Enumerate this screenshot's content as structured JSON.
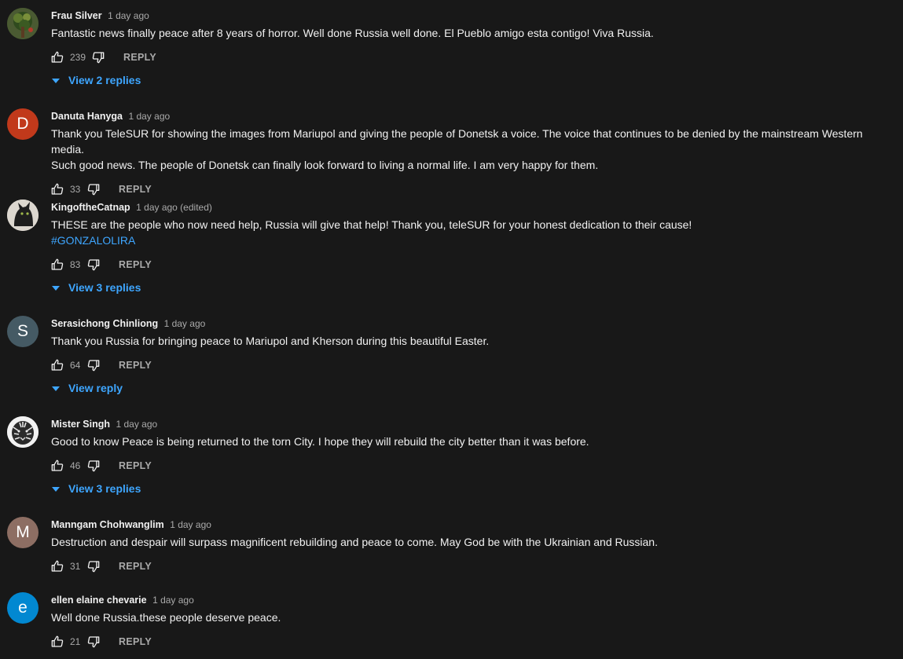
{
  "colors": {
    "background": "#181818",
    "text": "#f1f1f1",
    "secondary_text": "#aaaaaa",
    "link": "#3ea6ff"
  },
  "comments": [
    {
      "author": "Frau Silver",
      "time": "1 day ago",
      "text": "Fantastic news finally peace after 8 years of horror. Well done Russia well done. El Pueblo amigo esta contigo! Viva Russia.",
      "likes": "239",
      "reply_label": "REPLY",
      "replies_label": "View 2 replies",
      "avatar": {
        "type": "image",
        "icon": "profile-photo-tree"
      }
    },
    {
      "author": "Danuta Hanyga",
      "time": "1 day ago",
      "text": "Thank you TeleSUR for showing the images from Mariupol and giving the people of Donetsk a voice. The voice that continues to be denied by the mainstream Western media.\nSuch good news. The people of Donetsk can finally look forward to living a normal life. I am very happy for them.",
      "likes": "33",
      "reply_label": "REPLY",
      "avatar": {
        "type": "letter",
        "letter": "D",
        "color": "#c1391b"
      }
    },
    {
      "author": "KingoftheCatnap",
      "time": "1 day ago (edited)",
      "text": "THESE are the people who now need help, Russia will give that help! Thank you, teleSUR for your honest dedication to their cause!",
      "hashtag": "#GONZALOLIRA",
      "likes": "83",
      "reply_label": "REPLY",
      "replies_label": "View 3 replies",
      "avatar": {
        "type": "image",
        "icon": "profile-photo-cat"
      }
    },
    {
      "author": "Serasichong Chinliong",
      "time": "1 day ago",
      "text": "Thank you Russia for bringing peace to Mariupol and Kherson during this beautiful Easter.",
      "likes": "64",
      "reply_label": "REPLY",
      "replies_label": "View reply",
      "avatar": {
        "type": "letter",
        "letter": "S",
        "color": "#455a64"
      }
    },
    {
      "author": "Mister Singh",
      "time": "1 day ago",
      "text": "Good to know Peace is being returned to the torn City. I hope they will rebuild the city better than it was before.",
      "likes": "46",
      "reply_label": "REPLY",
      "replies_label": "View 3 replies",
      "avatar": {
        "type": "image",
        "icon": "profile-photo-tiger"
      }
    },
    {
      "author": "Manngam Chohwanglim",
      "time": "1 day ago",
      "text": "Destruction and despair will surpass magnificent rebuilding and peace to come. May God be with the Ukrainian and Russian.",
      "likes": "31",
      "reply_label": "REPLY",
      "avatar": {
        "type": "letter",
        "letter": "M",
        "color": "#8d6e63"
      }
    },
    {
      "author": "ellen elaine chevarie",
      "time": "1 day ago",
      "text": "Well done Russia.these people deserve peace.",
      "likes": "21",
      "reply_label": "REPLY",
      "avatar": {
        "type": "letter",
        "letter": "e",
        "color": "#0288d1"
      }
    }
  ]
}
